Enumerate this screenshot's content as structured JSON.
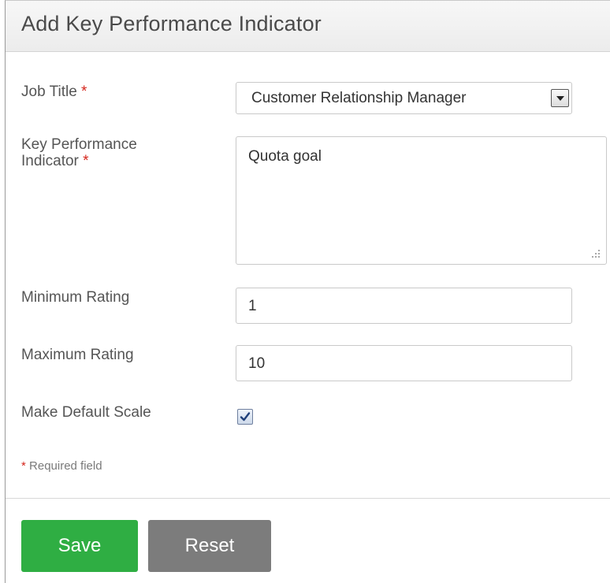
{
  "header": {
    "title": "Add Key Performance Indicator"
  },
  "form": {
    "job_title": {
      "label": "Job Title",
      "required_mark": "*",
      "value": "Customer Relationship Manager"
    },
    "kpi": {
      "label_line1": "Key Performance",
      "label_line2": "Indicator",
      "required_mark": "*",
      "value": "Quota goal"
    },
    "min_rating": {
      "label": "Minimum Rating",
      "value": "1"
    },
    "max_rating": {
      "label": "Maximum Rating",
      "value": "10"
    },
    "default_scale": {
      "label": "Make Default Scale",
      "checked": true
    },
    "required_note": {
      "mark": "*",
      "text": "Required field"
    }
  },
  "actions": {
    "save_label": "Save",
    "reset_label": "Reset"
  },
  "colors": {
    "save": "#2fae43",
    "reset": "#7c7c7c",
    "required": "#d5261c"
  },
  "icons": {
    "select_arrow": "chevron-down-icon",
    "checkbox_check": "checkmark-icon",
    "resize": "resize-grip-icon"
  }
}
